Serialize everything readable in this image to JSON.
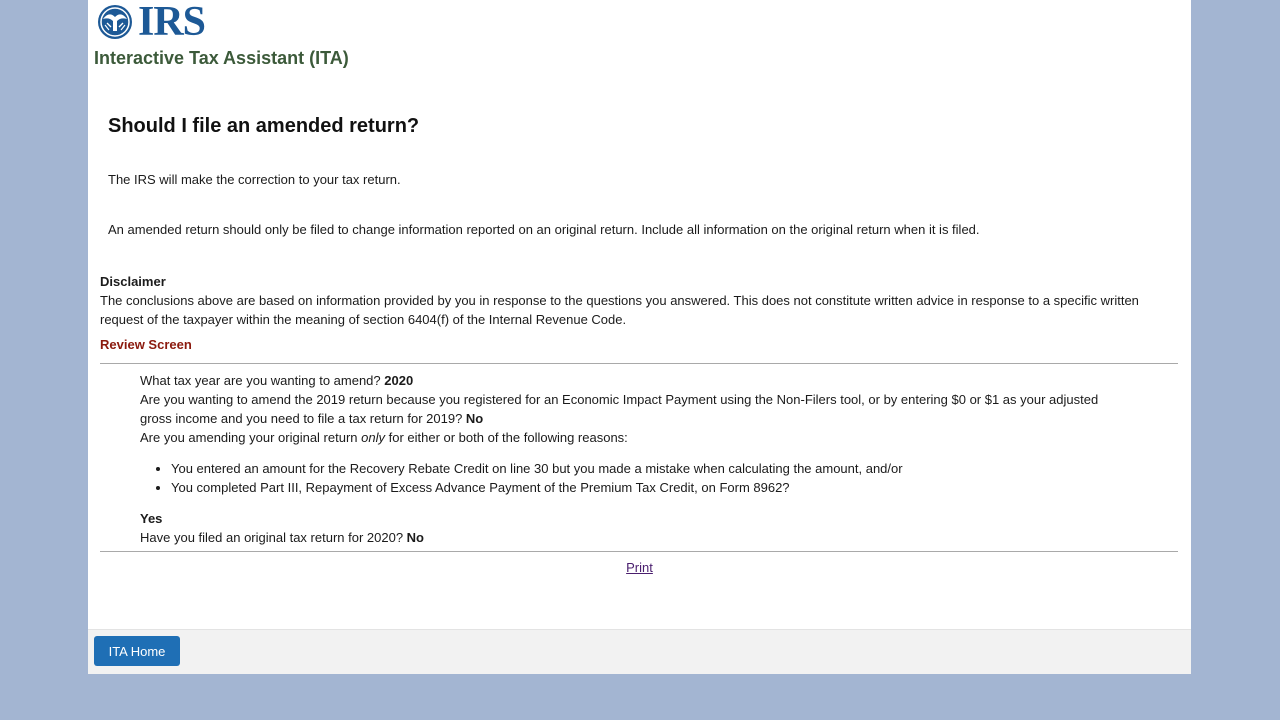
{
  "header": {
    "logo_text": "IRS",
    "app_title": "Interactive Tax Assistant (ITA)"
  },
  "main": {
    "heading": "Should I file an amended return?",
    "paragraphs": [
      "The IRS will make the correction to your tax return.",
      "An amended return should only be filed to change information reported on an original return. Include all information on the original return when it is filed."
    ]
  },
  "disclaimer": {
    "title": "Disclaimer",
    "text": "The conclusions above are based on information provided by you in response to the questions you answered. This does not constitute written advice in response to a specific written request of the taxpayer within the meaning of section 6404(f) of the Internal Revenue Code."
  },
  "review": {
    "title": "Review Screen",
    "q1": "What tax year are you wanting to amend? ",
    "a1": "2020",
    "q2": "Are you wanting to amend the 2019 return because you registered for an Economic Impact Payment using the Non-Filers tool, or by entering $0 or $1 as your adjusted gross income and you need to file a tax return for 2019? ",
    "a2": "No",
    "q3_pre": "Are you amending your original return ",
    "q3_em": "only",
    "q3_post": " for either or both of the following reasons:",
    "bullets": [
      "You entered an amount for the Recovery Rebate Credit on line 30 but you made a mistake when calculating the amount, and/or",
      "You completed Part III, Repayment of Excess Advance Payment of the Premium Tax Credit, on Form 8962?"
    ],
    "a3": "Yes",
    "q4": "Have you filed an original tax return for 2020? ",
    "a4": "No"
  },
  "actions": {
    "print_label": "Print",
    "home_label": "ITA Home"
  },
  "colors": {
    "background": "#a3b5d2",
    "brand_blue": "#1d5996",
    "button_blue": "#1f6fb5",
    "review_title": "#8b1a0e",
    "app_title": "#3c5a3a"
  }
}
